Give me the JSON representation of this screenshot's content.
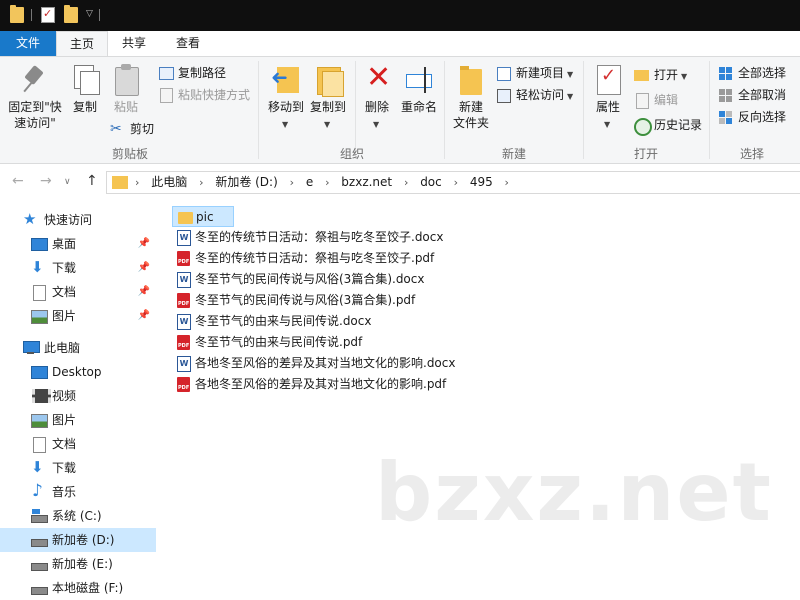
{
  "ribbon_tabs": {
    "file": "文件",
    "home": "主页",
    "share": "共享",
    "view": "查看"
  },
  "ribbon": {
    "clipboard": {
      "label": "剪贴板",
      "pin_quick_access_line1": "固定到\"快",
      "pin_quick_access_line2": "速访问\"",
      "copy": "复制",
      "paste": "粘贴",
      "copy_path": "复制路径",
      "paste_shortcut": "粘贴快捷方式",
      "cut": "剪切"
    },
    "organize": {
      "label": "组织",
      "move_to": "移动到",
      "copy_to": "复制到",
      "delete": "删除",
      "rename": "重命名"
    },
    "new": {
      "label": "新建",
      "new_folder_line1": "新建",
      "new_folder_line2": "文件夹",
      "new_item": "新建项目",
      "easy_access": "轻松访问"
    },
    "open": {
      "label": "打开",
      "properties": "属性",
      "open": "打开",
      "edit": "编辑",
      "history": "历史记录"
    },
    "select": {
      "label": "选择",
      "select_all": "全部选择",
      "select_none": "全部取消",
      "invert_selection": "反向选择"
    }
  },
  "address": {
    "crumbs": [
      "此电脑",
      "新加卷 (D:)",
      "e",
      "bzxz.net",
      "doc",
      "495"
    ]
  },
  "nav": {
    "quick_access": "快速访问",
    "quick_items": [
      "桌面",
      "下载",
      "文档",
      "图片"
    ],
    "this_pc": "此电脑",
    "pc_items": [
      "Desktop",
      "视频",
      "图片",
      "文档",
      "下载",
      "音乐",
      "系统 (C:)",
      "新加卷 (D:)",
      "新加卷 (E:)",
      "本地磁盘 (F:)"
    ]
  },
  "files": [
    {
      "name": "pic",
      "type": "folder"
    },
    {
      "name": "冬至的传统节日活动：祭祖与吃冬至饺子.docx",
      "type": "docx"
    },
    {
      "name": "冬至的传统节日活动：祭祖与吃冬至饺子.pdf",
      "type": "pdf"
    },
    {
      "name": "冬至节气的民间传说与风俗(3篇合集).docx",
      "type": "docx"
    },
    {
      "name": "冬至节气的民间传说与风俗(3篇合集).pdf",
      "type": "pdf"
    },
    {
      "name": "冬至节气的由来与民间传说.docx",
      "type": "docx"
    },
    {
      "name": "冬至节气的由来与民间传说.pdf",
      "type": "pdf"
    },
    {
      "name": "各地冬至风俗的差异及其对当地文化的影响.docx",
      "type": "docx"
    },
    {
      "name": "各地冬至风俗的差异及其对当地文化的影响.pdf",
      "type": "pdf"
    }
  ],
  "watermark": "bzxz.net",
  "colors": {
    "accent": "#1979ca",
    "selection": "#cce8ff",
    "folder": "#f5c451",
    "pdf": "#d5242b"
  }
}
